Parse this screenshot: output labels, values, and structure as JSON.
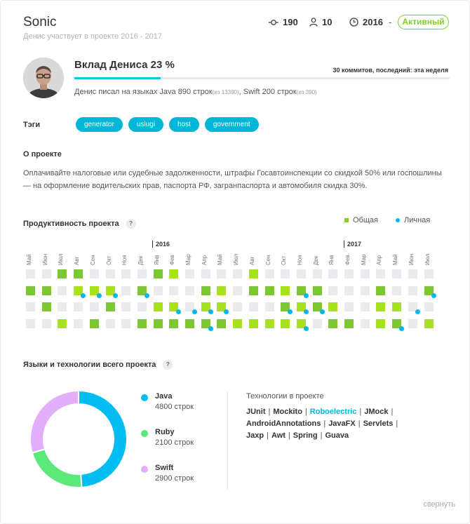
{
  "header": {
    "title": "Sonic",
    "subtitle": "Денис участвует в проекте 2016 - 2017",
    "commits_total": "190",
    "people": "10",
    "year": "2016",
    "dash": "-",
    "status": "Активный"
  },
  "contribution": {
    "title": "Вклад Дениса 23 %",
    "percent": 23,
    "commits_info": "30 коммитов, последний: эта неделя",
    "languages_prefix": "Денис писал на языках Java 890 строк",
    "java_total": "(из 13390)",
    "languages_mid": ", Swift 200 строк",
    "swift_total": "(из 390)"
  },
  "tags": {
    "label": "Тэги",
    "items": [
      "generator",
      "uslugi",
      "host",
      "government"
    ]
  },
  "about": {
    "label": "О проекте",
    "text": "Оплачивайте налоговые или судебные задолженности, штрафы Госавтоинспекции со скидкой 50% или госпошлины — на оформление водительских прав, паспорта РФ, загранпаспорта и автомобиля скидка 30%."
  },
  "productivity": {
    "title": "Продуктивность проекта",
    "help": "?",
    "legend_total": "Общая",
    "legend_personal": "Личная",
    "years": [
      "2016",
      "2017"
    ],
    "months": [
      "Май",
      "Июн",
      "Июл",
      "Авг",
      "Сен",
      "Окт",
      "Ноя",
      "Дек",
      "Янв",
      "Фев",
      "Мар",
      "Апр",
      "Май",
      "Июл",
      "Авг",
      "Сен",
      "Окт",
      "Ноя",
      "Дек",
      "Янв",
      "Фев",
      "Мар",
      "Апр",
      "Май",
      "Июн",
      "Июл"
    ],
    "levels": [
      [
        0,
        0,
        2,
        2,
        0,
        0,
        0,
        0,
        2,
        1,
        0,
        0,
        0,
        0,
        1,
        0,
        0,
        0,
        0,
        0,
        0,
        0,
        0,
        0,
        0,
        0
      ],
      [
        2,
        2,
        0,
        1,
        1,
        1,
        0,
        2,
        0,
        0,
        0,
        2,
        1,
        0,
        2,
        2,
        1,
        2,
        2,
        0,
        0,
        0,
        2,
        0,
        0,
        2
      ],
      [
        0,
        2,
        0,
        0,
        0,
        2,
        0,
        0,
        1,
        1,
        0,
        1,
        1,
        0,
        0,
        0,
        2,
        1,
        2,
        1,
        0,
        0,
        1,
        1,
        0,
        0
      ],
      [
        0,
        0,
        1,
        0,
        2,
        0,
        0,
        2,
        2,
        2,
        2,
        2,
        2,
        1,
        1,
        1,
        1,
        1,
        0,
        2,
        2,
        0,
        1,
        2,
        0,
        1
      ]
    ],
    "personal": [
      [
        0,
        0,
        0,
        0,
        0,
        0,
        0,
        0,
        0,
        0,
        0,
        0,
        0,
        0,
        0,
        0,
        0,
        0,
        0,
        0,
        0,
        0,
        0,
        0,
        0,
        0
      ],
      [
        0,
        0,
        0,
        1,
        1,
        1,
        0,
        1,
        0,
        0,
        0,
        0,
        0,
        0,
        0,
        0,
        0,
        1,
        0,
        0,
        0,
        0,
        0,
        0,
        0,
        1
      ],
      [
        0,
        0,
        0,
        0,
        0,
        0,
        0,
        0,
        0,
        1,
        1,
        1,
        1,
        0,
        0,
        0,
        1,
        1,
        1,
        0,
        0,
        0,
        0,
        0,
        1,
        0
      ],
      [
        0,
        0,
        0,
        0,
        0,
        0,
        0,
        0,
        0,
        0,
        0,
        1,
        0,
        0,
        0,
        0,
        0,
        1,
        0,
        0,
        0,
        0,
        0,
        1,
        0,
        0
      ]
    ],
    "colors": {
      "empty": "#ebebef",
      "light": "#a8e21f",
      "mid": "#7ec734",
      "dark": "#5a8f1f",
      "personal": "#00b7f0"
    }
  },
  "languages": {
    "title": "Языки и технологии всего проекта",
    "help": "?",
    "items": [
      {
        "name": "Java",
        "count": "4800 строк",
        "lines": 4800,
        "color": "#00bdf0"
      },
      {
        "name": "Ruby",
        "count": "2100 строк",
        "lines": 2100,
        "color": "#5ce87a"
      },
      {
        "name": "Swift",
        "count": "2900 строк",
        "lines": 2900,
        "color": "#e3aefc"
      }
    ],
    "tech_title": "Технологии в проекте",
    "tech_rows": [
      [
        {
          "t": "JUnit"
        },
        {
          "t": "Mockito"
        },
        {
          "t": "Roboelectric",
          "hl": true
        },
        {
          "t": "JMock"
        }
      ],
      [
        {
          "t": "AndroidAnnotations"
        },
        {
          "t": "JavaFX"
        },
        {
          "t": "Servlets"
        }
      ],
      [
        {
          "t": "Jaxp"
        },
        {
          "t": "Awt"
        },
        {
          "t": "Spring"
        },
        {
          "t": "Guava",
          "last": true
        }
      ]
    ],
    "separator": "|"
  },
  "footer": {
    "collapse": "свернуть"
  }
}
